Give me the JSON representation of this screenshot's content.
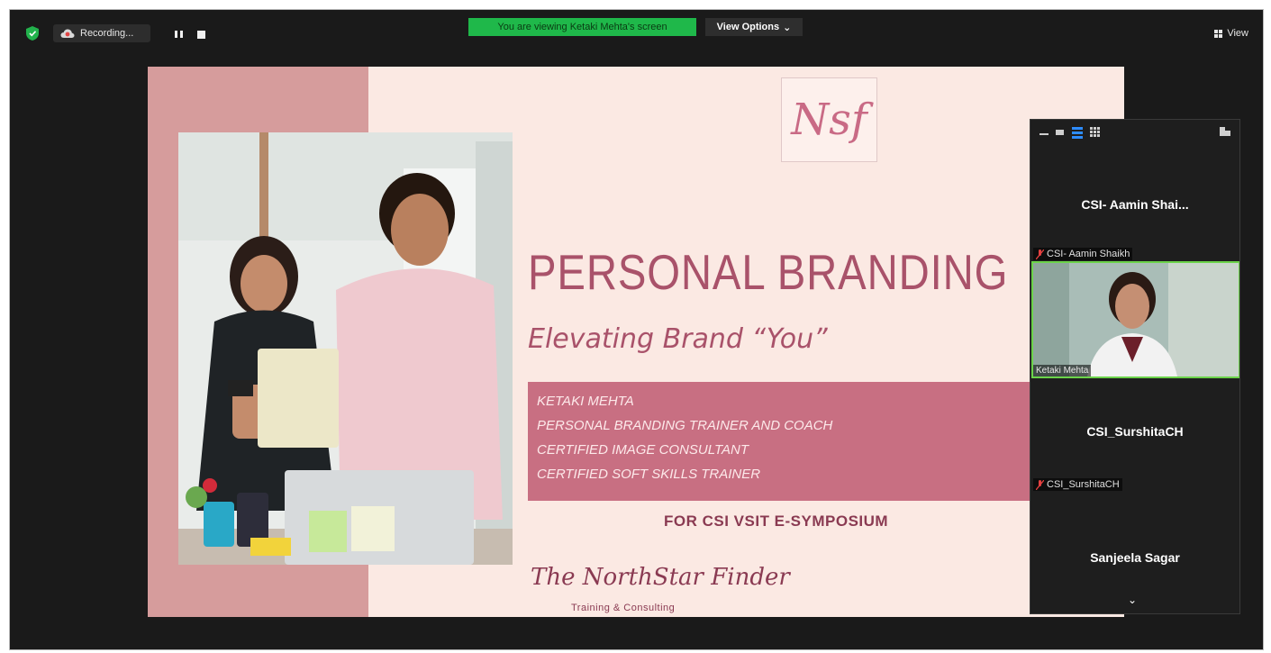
{
  "meeting": {
    "recording_label": "Recording...",
    "viewing_banner": "You are viewing Ketaki Mehta's screen",
    "view_options_label": "View Options",
    "view_label": "View"
  },
  "slide": {
    "logo_text": "Nsf",
    "title": "PERSONAL BRANDING",
    "subtitle": "Elevating Brand “You”",
    "details": [
      "KETAKI MEHTA",
      "PERSONAL BRANDING TRAINER AND COACH",
      "CERTIFIED IMAGE CONSULTANT",
      "CERTIFIED SOFT SKILLS TRAINER"
    ],
    "event": "FOR CSI VSIT E-SYMPOSIUM",
    "brand_name": "The NorthStar Finder",
    "brand_tagline": "Training & Consulting"
  },
  "participants": {
    "tile1_name": "CSI- Aamin Shai...",
    "tile1_tag": "CSI- Aamin Shaikh",
    "video_tag": "Ketaki Mehta",
    "tile3_name": "CSI_SurshitaCH",
    "tile3_tag": "CSI_SurshitaCH",
    "tile4_name": "Sanjeela Sagar"
  },
  "colors": {
    "accent_green": "#1fb84a",
    "slide_rose": "#a9526a",
    "slide_band": "#d69c9c",
    "details_box": "#c86f82",
    "active_speaker_border": "#6bd34a",
    "zoom_blue": "#2d8cff"
  }
}
